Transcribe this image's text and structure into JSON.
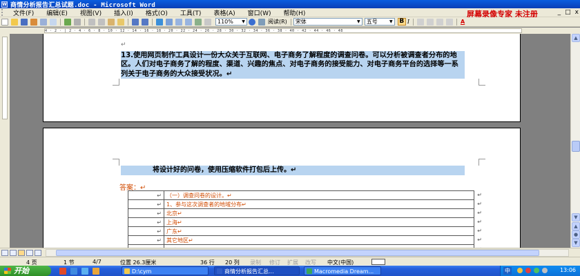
{
  "window": {
    "title": "商情分析报告汇总试题.doc - Microsoft Word",
    "app_icon": "word-doc-icon"
  },
  "menubar": {
    "items": [
      "文件(F)",
      "编辑(E)",
      "视图(V)",
      "插入(I)",
      "格式(O)",
      "工具(T)",
      "表格(A)",
      "窗口(W)",
      "帮助(H)"
    ],
    "watermark": "屏幕录像专家 未注册",
    "window_controls": [
      "_",
      "□",
      "x"
    ]
  },
  "toolbar": {
    "zoom": "110%",
    "read_label": "阅读(R)",
    "font_name": "宋体",
    "font_size": "五号",
    "bold": "B",
    "italic": "I",
    "font_color_label": "A"
  },
  "ruler": {
    "marks": "4 · 2 · | 2 · 4 · 6 · 8 · 10 · 12 · 14 · 16 · 18 · 20 · 22 · 24 · 26 · 28 · 30 · 32 · 34 · 36 · 38 · 40 · 42 · 44 · 46 · 48"
  },
  "document": {
    "page1_mark": "↵",
    "para13": "13.使用网页制作工具设计一份大众关于互联网、电子商务了解程度的调查问卷。可以分析被调查者分布的地区。人们对电子商务了解的程度、渠道、兴趣的焦点、对电子商务的接受能力、对电子商务平台的选择等一系列关于电子商务的大众接受状况。↵",
    "upload": "将设计好的问卷，使用压缩软件打包后上传。↵",
    "answer": "答案：↵",
    "table": {
      "rows": [
        {
          "c1": "↵",
          "c2": "（一）调查问卷的设计。↵",
          "end": "↵"
        },
        {
          "c1": "↵",
          "c2": "1、参与这次调查者的地域分布↵",
          "end": "↵"
        },
        {
          "c1": "↵",
          "c2": "北京↵",
          "end": "↵"
        },
        {
          "c1": "↵",
          "c2": "上海↵",
          "end": "↵"
        },
        {
          "c1": "↵",
          "c2": "广东↵",
          "end": "↵"
        },
        {
          "c1": "↵",
          "c2": "其它地区↵",
          "end": "↵"
        },
        {
          "c1": "↵",
          "c2": "↵",
          "end": "↵"
        }
      ]
    }
  },
  "statusbar": {
    "page": "4 页",
    "section": "1 节",
    "page_of": "4/7",
    "position": "位置 26.3厘米",
    "line": "36 行",
    "col": "20 列",
    "rec": "录制",
    "trk": "修订",
    "ext": "扩展",
    "ovr": "改写",
    "lang": "中文(中国)"
  },
  "taskbar": {
    "start": "开始",
    "tasks": [
      "D:\\cym",
      "商情分析报告汇总...",
      "Macromedia Dream..."
    ],
    "ime": "中",
    "clock": "13:06"
  },
  "colors": {
    "selection": "#b8d4f0",
    "answer_text": "#d04a00",
    "watermark": "#d40000"
  }
}
